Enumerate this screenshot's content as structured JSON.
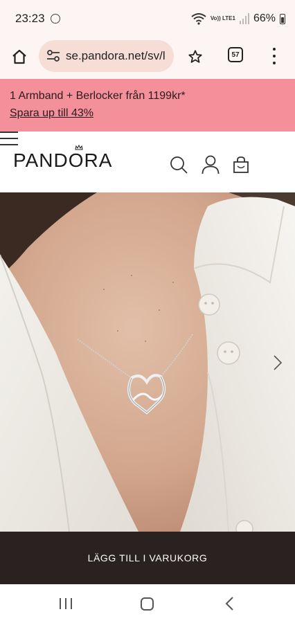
{
  "status_bar": {
    "time": "23:23",
    "network_label": "Vo)) LTE1",
    "battery_percent": "66%"
  },
  "browser": {
    "url": "se.pandora.net/sv/l",
    "tab_count": "57"
  },
  "promo": {
    "text": "1 Armband + Berlocker från 1199kr*",
    "link": "Spara up till 43%",
    "color": "#f4909a"
  },
  "header": {
    "logo": "PANDORA"
  },
  "hero": {
    "icon": "chevron-right-icon"
  },
  "cart": {
    "label": "LÄGG TILL I VARUKORG",
    "color": "#2a2220"
  },
  "nav": {
    "icons": [
      "recents-icon",
      "home-icon",
      "back-icon"
    ]
  }
}
